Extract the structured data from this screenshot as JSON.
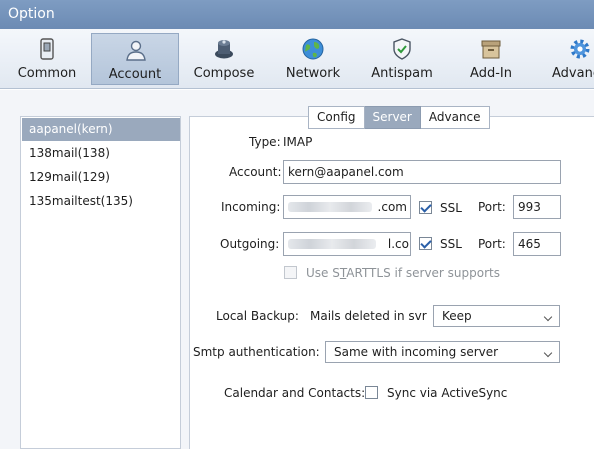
{
  "window": {
    "title": "Option"
  },
  "toolbar": {
    "items": [
      {
        "label": "Common",
        "icon": "phone-icon"
      },
      {
        "label": "Account",
        "icon": "user-icon"
      },
      {
        "label": "Compose",
        "icon": "compose-icon"
      },
      {
        "label": "Network",
        "icon": "globe-icon"
      },
      {
        "label": "Antispam",
        "icon": "shield-icon"
      },
      {
        "label": "Add-In",
        "icon": "box-icon"
      },
      {
        "label": "Advance",
        "icon": "gear-icon"
      }
    ],
    "active": "Account"
  },
  "accounts": [
    {
      "label": "aapanel(kern)"
    },
    {
      "label": "138mail(138)"
    },
    {
      "label": "129mail(129)"
    },
    {
      "label": "135mailtest(135)"
    }
  ],
  "tabs": [
    {
      "label": "Config"
    },
    {
      "label": "Server"
    },
    {
      "label": "Advance"
    }
  ],
  "form": {
    "type_label": "Type:",
    "type_value": "IMAP",
    "account_label": "Account:",
    "account_value": "kern@aapanel.com",
    "incoming_label": "Incoming:",
    "incoming_value": ".com",
    "outgoing_label": "Outgoing:",
    "outgoing_value": "l.co",
    "ssl_label": "SSL",
    "port_label": "Port:",
    "incoming_port": "993",
    "outgoing_port": "465",
    "starttls_pre": "Use S",
    "starttls_u": "T",
    "starttls_post": "ARTTLS if server supports",
    "local_backup_label": "Local Backup:",
    "mails_deleted_label": "Mails deleted in svr",
    "backup_select": "Keep",
    "smtp_auth_label": "Smtp authentication:",
    "smtp_auth_select": "Same with incoming server",
    "calendar_label": "Calendar and Contacts:",
    "activesync_label": "Sync via ActiveSync"
  },
  "colors": {
    "titlebar": "#7191bb",
    "selection": "#9aa9bd",
    "accent": "#2a5fa8"
  }
}
